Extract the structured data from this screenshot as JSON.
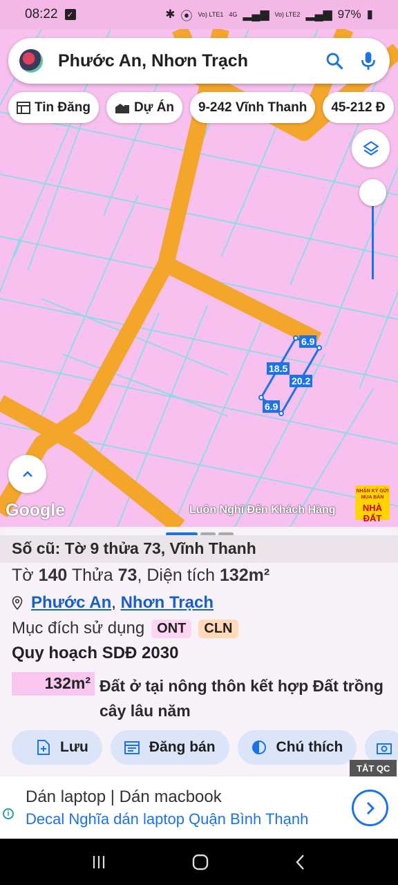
{
  "status_bar": {
    "time": "08:22",
    "network_1": "Vo) LTE1",
    "network_2": "Vo) LTE2",
    "network_type": "4G",
    "battery": "97%"
  },
  "search": {
    "query": "Phước An, Nhơn Trạch"
  },
  "chips": [
    {
      "label": "Tin Đăng",
      "icon": "table-icon"
    },
    {
      "label": "Dự Án",
      "icon": "buildings-icon"
    },
    {
      "label": "9-242 Vĩnh Thanh"
    },
    {
      "label": "45-212 Đ"
    }
  ],
  "map": {
    "parcel_dimensions": {
      "top": "6.9",
      "left": "18.5",
      "right": "20.2",
      "bottom": "6.9"
    },
    "google_label": "Google",
    "watermark": "Luôn Nghĩ Đến Khách Hàng",
    "ad_badge_small": "NHẬN KÝ GỬI MUA BÁN",
    "ad_badge_big": "NHÀ ĐẤT",
    "colors": {
      "land": "#f8c0ef",
      "road": "#f4a62a",
      "lines": "#8fd9e8",
      "parcel": "#1a73e8"
    }
  },
  "sheet": {
    "old_ref": "Số cũ: Tờ 9 thửa 73, Vĩnh Thanh",
    "sheet_label": "Tờ",
    "sheet_no": "140",
    "parcel_label": "Thửa",
    "parcel_no": "73",
    "area_label": "Diện tích",
    "area_value": "132m²",
    "location_1": "Phước An",
    "location_2": "Nhơn Trạch",
    "purpose_label": "Mục đích sử dụng",
    "tag_1": "ONT",
    "tag_2": "CLN",
    "plan_title": "Quy hoạch SDĐ 2030",
    "plan_area": "132m²",
    "plan_desc": "Đất ở tại nông thôn kết hợp Đất trồng cây lâu năm"
  },
  "actions": [
    {
      "label": "Lưu",
      "icon": "add-file-icon"
    },
    {
      "label": "Đăng bán",
      "icon": "calendar-icon"
    },
    {
      "label": "Chú thích",
      "icon": "contrast-icon"
    }
  ],
  "ad": {
    "close_label": "TẮT QC",
    "title": "Dán laptop | Dán macbook",
    "subtitle": "Decal Nghĩa dán laptop Quận Bình Thạnh"
  }
}
